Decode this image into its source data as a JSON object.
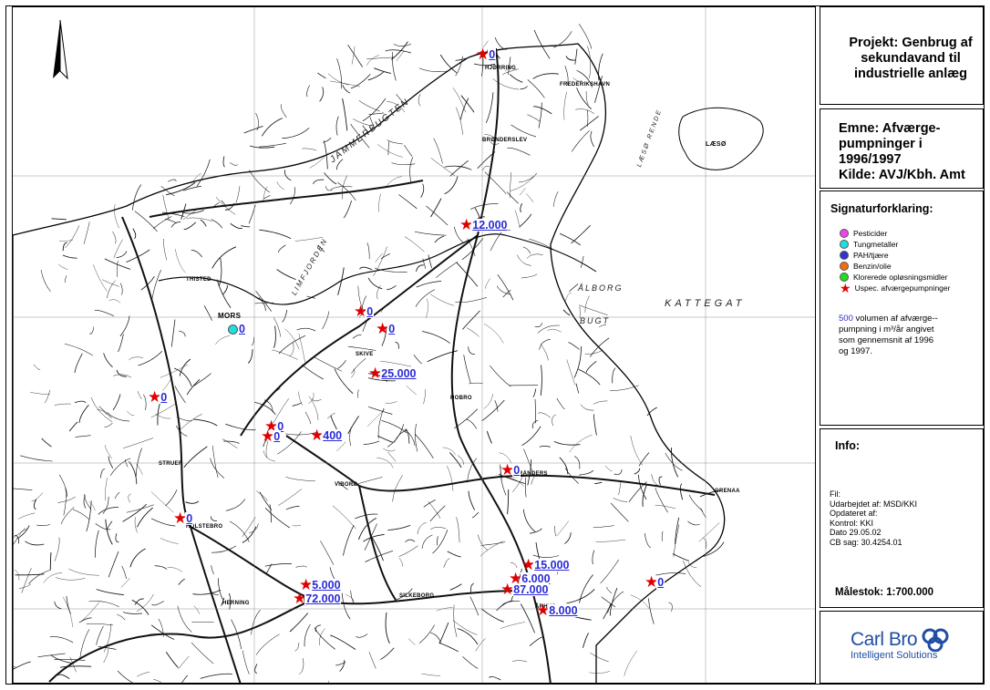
{
  "project": {
    "lines": [
      "Projekt: Genbrug af",
      "sekundavand til",
      "industrielle anlæg"
    ]
  },
  "topic": {
    "lines": [
      "Emne: Afværge-",
      "pumpninger i",
      "1996/1997",
      "Kilde: AVJ/Kbh. Amt"
    ]
  },
  "legend": {
    "title": "Signaturforklaring:",
    "items": [
      {
        "label": "Pesticider",
        "color": "#ee44ee"
      },
      {
        "label": "Tungmetaller",
        "color": "#22dddd"
      },
      {
        "label": "PAH/tjære",
        "color": "#3333cc"
      },
      {
        "label": "Benzin/olie",
        "color": "#f07010"
      },
      {
        "label": "Klorerede opløsningsmidler",
        "color": "#22dd22"
      }
    ],
    "star_label": "Uspec. afværgepumpninger",
    "note_value": "500",
    "note_lines": [
      " volumen af afværge--",
      "pumpning i m³/år angivet",
      "som gennemsnit af 1996",
      "og 1997."
    ]
  },
  "info": {
    "title": "Info:",
    "lines": [
      "Fil:",
      "Udarbejdet af: MSD/KKI",
      "Opdateret af:",
      "Kontrol: KKI",
      "Dato 29.05.02",
      "CB sag: 30.4254.01"
    ],
    "scale": "Målestok: 1:700.000"
  },
  "logo": {
    "name": "Carl Bro",
    "tagline": "Intelligent Solutions",
    "icon": "carl-bro-rings-icon",
    "color": "#1f4ea3"
  },
  "map": {
    "north_arrow_icon": "north-arrow-icon",
    "place_labels": [
      "HJØRRING",
      "FREDERIKSHAVN",
      "BRØNDERSLEV",
      "LÆSØ",
      "THISTED",
      "MORS",
      "SKIVE",
      "HOBRO",
      "VIBORG",
      "RANDERS",
      "GRENAA",
      "HOLSTEBRO",
      "HERNING",
      "SILKEBORG",
      "ÅRHUS",
      "STRUER"
    ],
    "sea_labels": [
      "JAMMERBUGTEN",
      "LIMFJORDEN",
      "ÅLBORG",
      "BUGT",
      "KATTEGAT",
      "LÆSØ RENDE"
    ],
    "markers": [
      {
        "value": "0",
        "kind": "star"
      },
      {
        "value": "12.000",
        "kind": "star"
      },
      {
        "value": "0",
        "kind": "star"
      },
      {
        "value": "0",
        "kind": "star"
      },
      {
        "value": "0",
        "kind": "pah"
      },
      {
        "value": "25.000",
        "kind": "star"
      },
      {
        "value": "0",
        "kind": "star"
      },
      {
        "value": "0",
        "kind": "star"
      },
      {
        "value": "0",
        "kind": "star"
      },
      {
        "value": "400",
        "kind": "star"
      },
      {
        "value": "0",
        "kind": "star"
      },
      {
        "value": "0",
        "kind": "star"
      },
      {
        "value": "15.000",
        "kind": "star"
      },
      {
        "value": "6.000",
        "kind": "star"
      },
      {
        "value": "87.000",
        "kind": "star"
      },
      {
        "value": "8.000",
        "kind": "star"
      },
      {
        "value": "0",
        "kind": "star"
      },
      {
        "value": "5.000",
        "kind": "star"
      },
      {
        "value": "72.000",
        "kind": "star"
      }
    ]
  }
}
